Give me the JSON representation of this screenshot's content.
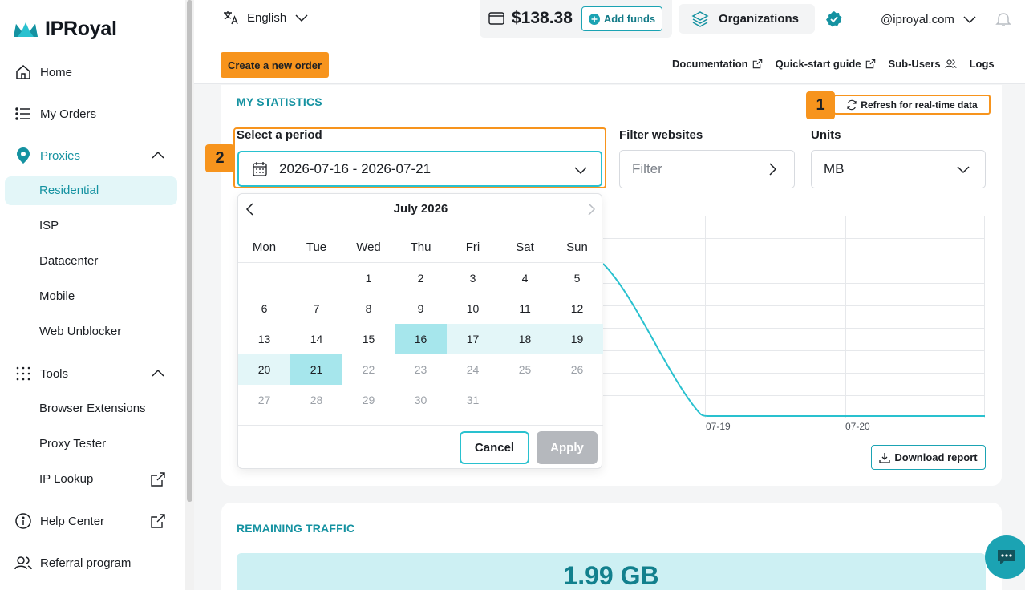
{
  "brand": {
    "name": "IPRoyal"
  },
  "sidebar": {
    "home": "Home",
    "orders": "My Orders",
    "proxies": "Proxies",
    "proxy_items": [
      "Residential",
      "ISP",
      "Datacenter",
      "Mobile",
      "Web Unblocker"
    ],
    "tools": "Tools",
    "tool_items": [
      "Browser Extensions",
      "Proxy Tester",
      "IP Lookup"
    ],
    "help": "Help Center",
    "referral": "Referral program"
  },
  "topbar": {
    "language": "English",
    "balance": "$138.38",
    "add_funds": "Add funds",
    "organizations": "Organizations",
    "user_email": "@iproyal.com",
    "create_order": "Create a new order",
    "links": [
      "Documentation",
      "Quick-start guide",
      "Sub-Users",
      "Logs"
    ]
  },
  "stats": {
    "title": "MY STATISTICS",
    "refresh": "Refresh for real-time data",
    "badge1": "1",
    "badge2": "2",
    "period_label": "Select a period",
    "period_value": "2026-07-16 - 2026-07-21",
    "filter_label": "Filter websites",
    "filter_placeholder": "Filter",
    "units_label": "Units",
    "units_value": "MB",
    "x_ticks": [
      "07-19",
      "07-20"
    ],
    "download": "Download report"
  },
  "calendar": {
    "month": "July 2026",
    "weekdays": [
      "Mon",
      "Tue",
      "Wed",
      "Thu",
      "Fri",
      "Sat",
      "Sun"
    ],
    "weeks": [
      [
        "",
        "",
        "1",
        "2",
        "3",
        "4",
        "5"
      ],
      [
        "6",
        "7",
        "8",
        "9",
        "10",
        "11",
        "12"
      ],
      [
        "13",
        "14",
        "15",
        "16",
        "17",
        "18",
        "19"
      ],
      [
        "20",
        "21",
        "22",
        "23",
        "24",
        "25",
        "26"
      ],
      [
        "27",
        "28",
        "29",
        "30",
        "31",
        "",
        ""
      ]
    ],
    "cancel": "Cancel",
    "apply": "Apply"
  },
  "traffic": {
    "title": "REMAINING TRAFFIC",
    "value": "1.99 GB"
  },
  "colors": {
    "accent": "#1ba3b3",
    "highlight": "#f7941d"
  }
}
